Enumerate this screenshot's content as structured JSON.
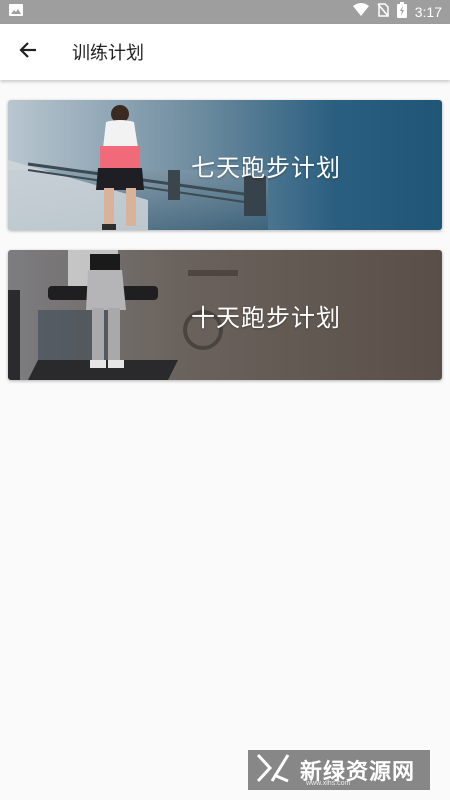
{
  "status_bar": {
    "time": "3:17",
    "icons": [
      "image-icon",
      "wifi-icon",
      "no-sim-icon",
      "battery-charging-icon"
    ]
  },
  "app_bar": {
    "title": "训练计划",
    "back_icon": "arrow-left-icon"
  },
  "plans": [
    {
      "label": "七天跑步计划"
    },
    {
      "label": "十天跑步计划"
    }
  ],
  "watermark": {
    "text": "新绿资源网",
    "url": "www.xlhs.com"
  },
  "colors": {
    "status_bar": "#9e9e9e",
    "app_bar": "#ffffff",
    "background": "#fafafa",
    "card1_overlay": "#1f5576",
    "card2_overlay": "#5a4f48"
  }
}
